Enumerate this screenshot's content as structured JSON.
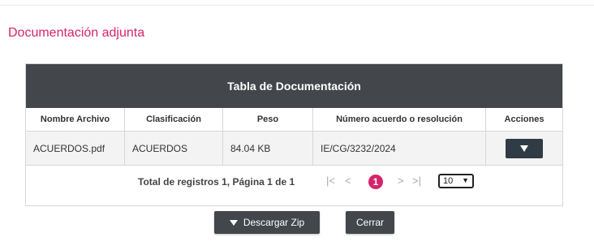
{
  "section_title": "Documentación adjunta",
  "table": {
    "title": "Tabla de Documentación",
    "columns": [
      "Nombre Archivo",
      "Clasificación",
      "Peso",
      "Número acuerdo o resolución",
      "Acciones"
    ],
    "rows": [
      {
        "nombre": "ACUERDOS.pdf",
        "clasificacion": "ACUERDOS",
        "peso": "84.04 KB",
        "numero": "IE/CG/3232/2024"
      }
    ]
  },
  "pagination": {
    "summary": "Total de registros 1, Página 1 de 1",
    "first": "|<",
    "prev": "<",
    "current_page": "1",
    "next": ">",
    "last": ">|",
    "page_size": "10"
  },
  "buttons": {
    "download_zip": "Descargar Zip",
    "close": "Cerrar"
  },
  "colors": {
    "accent": "#d6246b",
    "header_bg": "#43464b",
    "action_btn": "#2f3b45"
  },
  "icons": {
    "row_action": "caret-down-icon",
    "download": "caret-down-icon"
  }
}
